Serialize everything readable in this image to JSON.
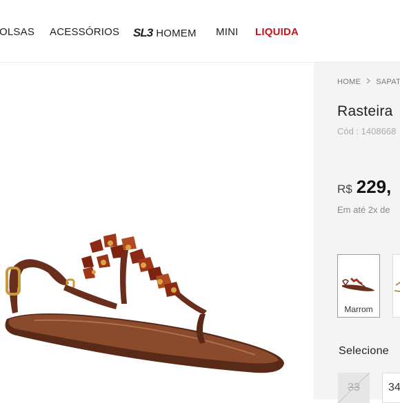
{
  "nav": {
    "items": [
      {
        "label": "OLSAS"
      },
      {
        "label": "ACESSÓRIOS"
      },
      {
        "logo": "SL3",
        "label": "HOMEM"
      },
      {
        "label": "MINI"
      },
      {
        "label": "LIQUIDA"
      }
    ],
    "sale_color": "#c0161f"
  },
  "product": {
    "image_icon": "brown-jeweled-thong-sandal",
    "breadcrumb": [
      "HOME",
      "SAPAT"
    ],
    "title": "Rasteira",
    "code": "Cód : 1408668",
    "price_currency": "R$",
    "price_value": "229,",
    "installments": "Em até 2x de",
    "colors": [
      {
        "label": "Marrom",
        "selected": true
      }
    ],
    "select_label": "Selecione",
    "sizes": [
      {
        "label": "33",
        "available": false
      },
      {
        "label": "34",
        "available": true
      }
    ]
  }
}
